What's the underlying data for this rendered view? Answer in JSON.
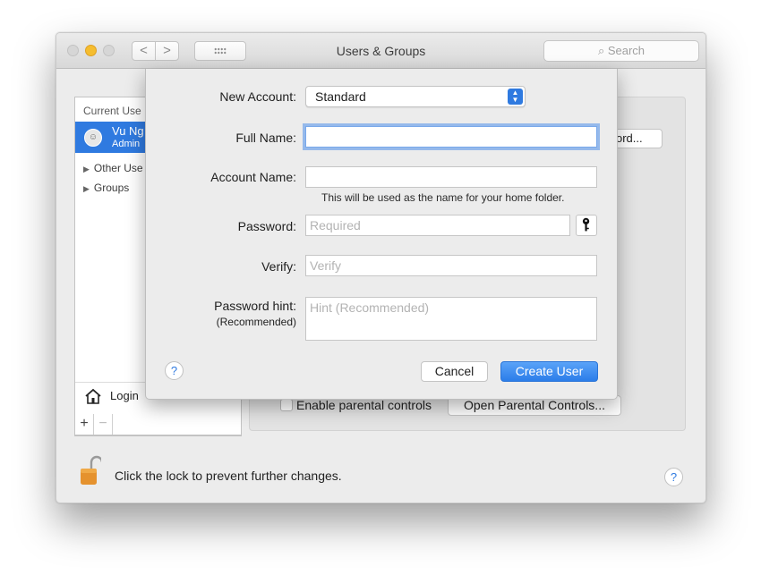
{
  "window": {
    "title": "Users & Groups",
    "search_placeholder": "Search",
    "nav_back": "<",
    "nav_forward": ">"
  },
  "sidebar": {
    "header": "Current Use",
    "current_user": {
      "name": "Vu Ng",
      "role": "Admin"
    },
    "items": [
      {
        "label": "Other Use",
        "icon": "triangle-right-icon"
      },
      {
        "label": "Groups",
        "icon": "triangle-right-icon"
      }
    ],
    "login_label": "Login",
    "add_label": "+",
    "remove_label": "−"
  },
  "background": {
    "password_button_label": "ord...",
    "enable_parental_label": "Enable parental controls",
    "open_parental_button": "Open Parental Controls...",
    "lock_text": "Click the lock to prevent further changes.",
    "help_label": "?"
  },
  "sheet": {
    "new_account": {
      "label": "New Account:",
      "value": "Standard"
    },
    "full_name": {
      "label": "Full Name:",
      "value": ""
    },
    "account_name": {
      "label": "Account Name:",
      "value": "",
      "hint": "This will be used as the name for your home folder."
    },
    "password": {
      "label": "Password:",
      "placeholder": "Required"
    },
    "verify": {
      "label": "Verify:",
      "placeholder": "Verify"
    },
    "password_hint": {
      "label": "Password hint:",
      "sublabel": "(Recommended)",
      "placeholder": "Hint (Recommended)"
    },
    "help_label": "?",
    "cancel_label": "Cancel",
    "create_label": "Create User"
  },
  "colors": {
    "accent": "#2f7ae0",
    "traffic_minimize": "#f5bd2f",
    "window_bg": "#ececec"
  }
}
